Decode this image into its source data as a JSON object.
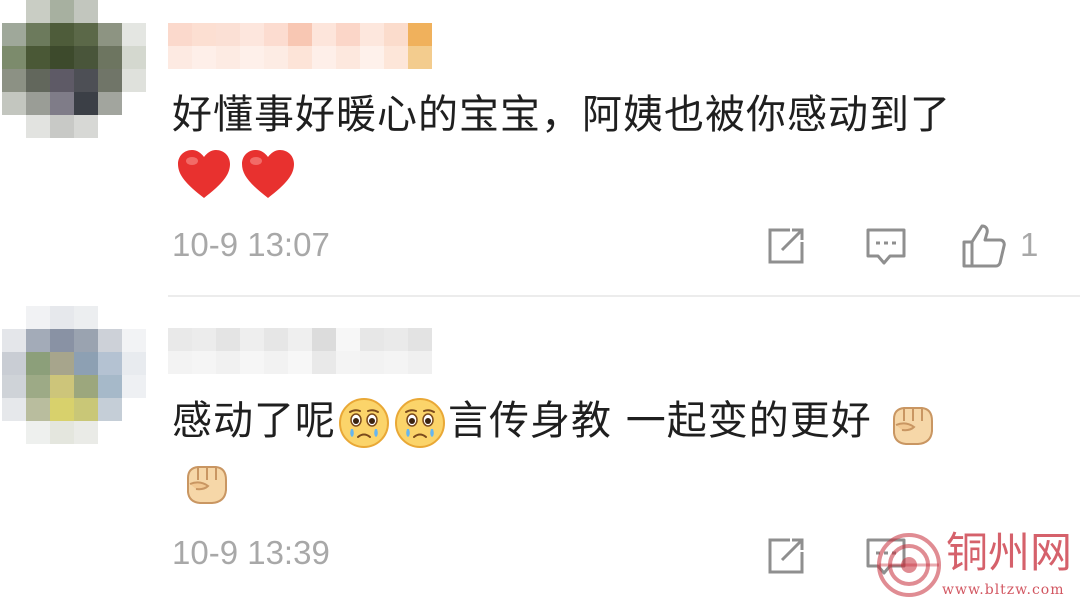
{
  "comments": [
    {
      "text": "好懂事好暖心的宝宝，阿姨也被你感动到了",
      "emojis": [
        "heart-icon",
        "heart-icon"
      ],
      "time": "10-9 13:07",
      "likes": "1"
    },
    {
      "text_part1": "感动了呢",
      "text_part2": "言传身教 一起变的更好",
      "emojis_inline": [
        "teary-face-icon",
        "teary-face-icon"
      ],
      "emojis_after": [
        "fist-icon",
        "fist-icon"
      ],
      "time": "10-9 13:39"
    }
  ],
  "watermark": {
    "name": "铜州网",
    "url": "www.bltzw.com"
  },
  "colors": {
    "text": "#1f1f1f",
    "meta": "#a8a8a8",
    "heart": "#e8312f",
    "divider": "#ececec",
    "watermark": "#c72d3a"
  }
}
